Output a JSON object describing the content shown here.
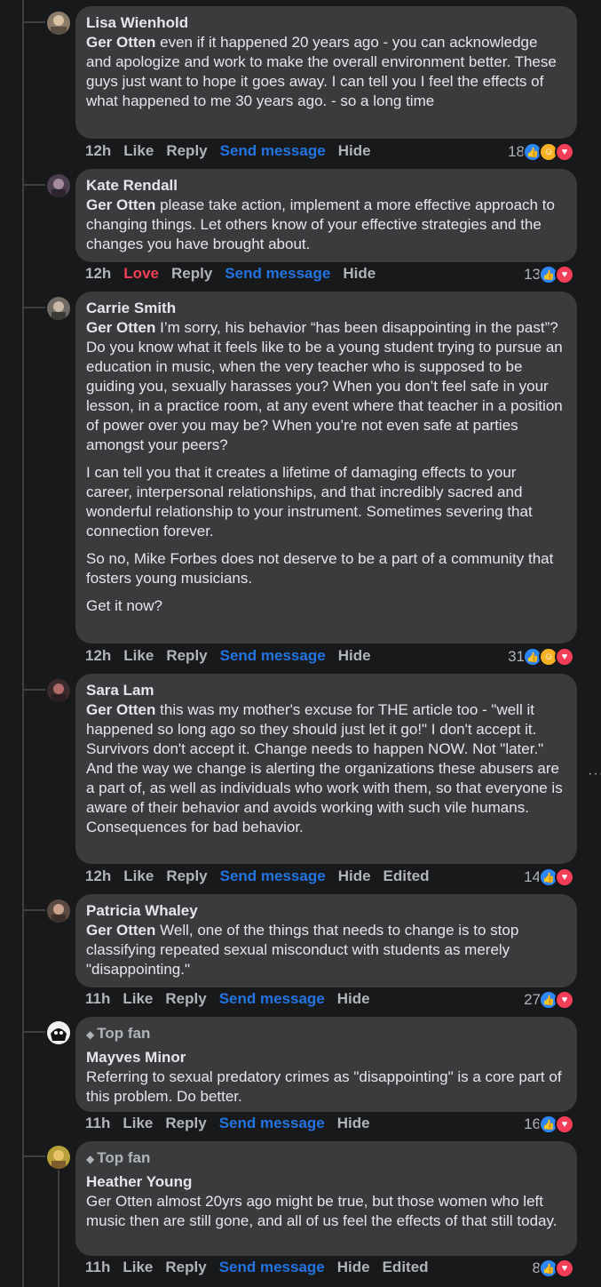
{
  "comments": [
    {
      "author": "Lisa Wienhold",
      "tag": "Ger Otten",
      "paras": [
        "even if it happened 20 years ago - you can acknowledge and apologize and work to make the overall environment better. These guys just want to hope it goes away. I can tell you I feel the effects of what happened to me 30 years ago. - so a long time"
      ],
      "time": "12h",
      "like": "Like",
      "reply": "Reply",
      "send": "Send message",
      "hide": "Hide",
      "reaction_count": "18"
    },
    {
      "author": "Kate Rendall",
      "tag": "Ger Otten",
      "paras": [
        "please take action, implement a more effective approach to changing things. Let others know of your effective strategies and the changes you have brought about."
      ],
      "time": "12h",
      "like": "Love",
      "reply": "Reply",
      "send": "Send message",
      "hide": "Hide",
      "reaction_count": "13"
    },
    {
      "author": "Carrie Smith",
      "tag": "Ger Otten",
      "paras": [
        "I’m sorry, his behavior “has been disappointing in the past”? Do you know what it feels like to be a young student trying to pursue an education in music, when the very teacher who is supposed to be guiding you, sexually harasses you? When you don’t feel safe in your lesson, in a practice room, at any event where that teacher in a position of power over you may be? When you’re not even safe at parties amongst your peers?",
        "I can tell you that it creates a lifetime of damaging effects to your career, interpersonal relationships, and that incredibly sacred and wonderful relationship to your instrument. Sometimes severing that connection forever.",
        "So no, Mike Forbes does not deserve to be a part of a community that fosters young musicians.",
        "Get it now?"
      ],
      "time": "12h",
      "like": "Like",
      "reply": "Reply",
      "send": "Send message",
      "hide": "Hide",
      "reaction_count": "31"
    },
    {
      "author": "Sara Lam",
      "tag": "Ger Otten",
      "paras": [
        "this was my mother's excuse for THE article too - \"well it happened so long ago so they should just let it go!\" I don't accept it. Survivors don't accept it. Change needs to happen NOW. Not \"later.\" And the way we change is alerting the organizations these abusers are a part of, as well as individuals who work with them, so that everyone is aware of their behavior and avoids working with such vile humans. Consequences for bad behavior."
      ],
      "time": "12h",
      "like": "Like",
      "reply": "Reply",
      "send": "Send message",
      "hide": "Hide",
      "edited": "Edited",
      "reaction_count": "14"
    },
    {
      "author": "Patricia Whaley",
      "tag": "Ger Otten",
      "paras": [
        "Well, one of the things that needs to change is to stop classifying repeated sexual misconduct with students as merely \"disappointing.\""
      ],
      "time": "11h",
      "like": "Like",
      "reply": "Reply",
      "send": "Send message",
      "hide": "Hide",
      "reaction_count": "27"
    },
    {
      "badge": "Top fan",
      "author": "Mayves Minor",
      "tag": "",
      "paras": [
        "Referring to sexual predatory crimes as \"disappointing\" is a core part of this problem. Do better."
      ],
      "time": "11h",
      "like": "Like",
      "reply": "Reply",
      "send": "Send message",
      "hide": "Hide",
      "reaction_count": "16"
    },
    {
      "badge": "Top fan",
      "author": "Heather Young",
      "tag": "",
      "paras": [
        "Ger Otten almost 20yrs ago might be true, but those women who left music then are still gone, and all of us feel the effects of that still today."
      ],
      "time": "11h",
      "like": "Like",
      "reply": "Reply",
      "send": "Send message",
      "hide": "Hide",
      "edited": "Edited",
      "reaction_count": "8"
    }
  ],
  "more_glyph": "···",
  "icons": {
    "like": "like-icon",
    "love": "love-icon",
    "care": "care-icon",
    "gem": "diamond-icon"
  },
  "colors": {
    "background": "#18191a",
    "bubble": "#3a3b3c",
    "link": "#2374e1",
    "love": "#f33e58"
  }
}
